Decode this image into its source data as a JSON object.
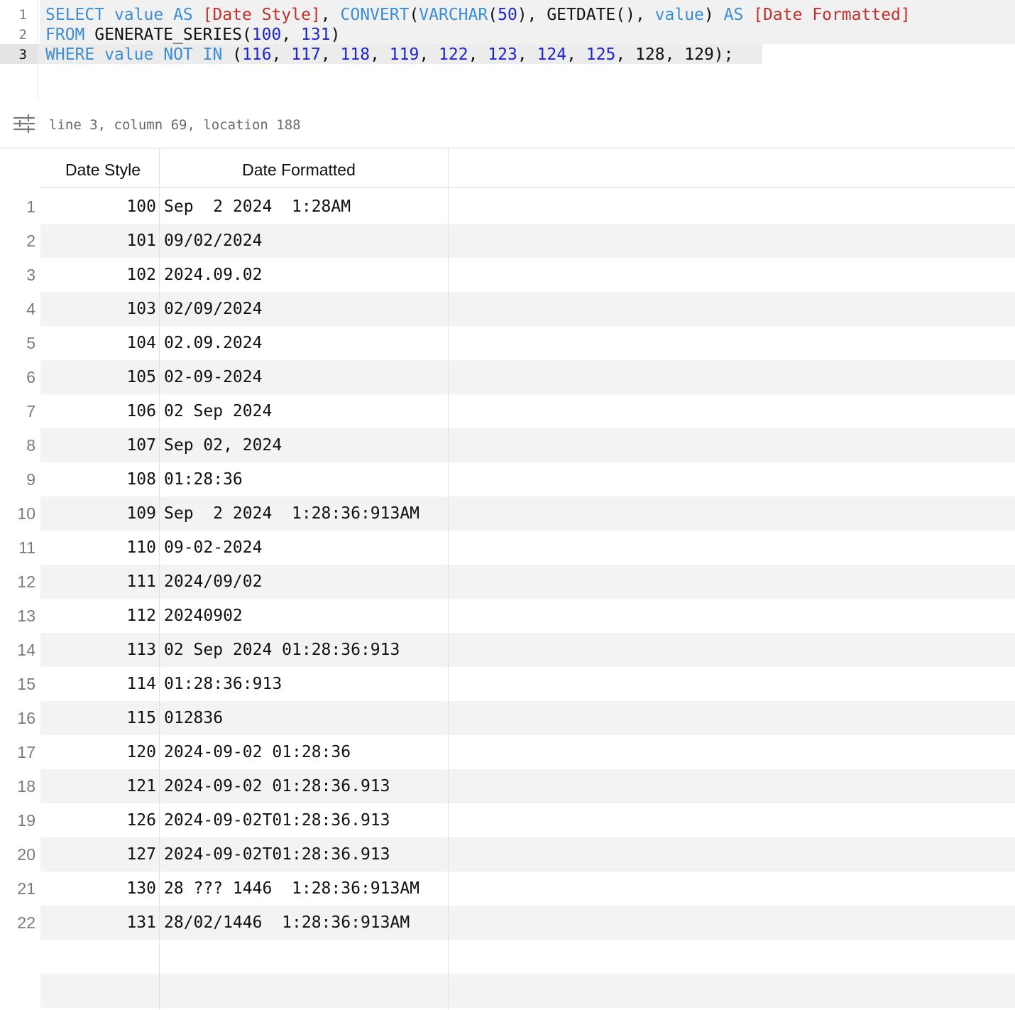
{
  "editor": {
    "line_numbers": [
      "1",
      "2",
      "3"
    ],
    "lines": [
      [
        {
          "t": "SELECT",
          "c": "kw"
        },
        {
          "t": " ",
          "c": "pl"
        },
        {
          "t": "value",
          "c": "kw"
        },
        {
          "t": " ",
          "c": "pl"
        },
        {
          "t": "AS",
          "c": "kw"
        },
        {
          "t": " ",
          "c": "pl"
        },
        {
          "t": "[Date Style]",
          "c": "str"
        },
        {
          "t": ", ",
          "c": "pl"
        },
        {
          "t": "CONVERT",
          "c": "kw"
        },
        {
          "t": "(",
          "c": "pl"
        },
        {
          "t": "VARCHAR",
          "c": "kw"
        },
        {
          "t": "(",
          "c": "pl"
        },
        {
          "t": "50",
          "c": "num"
        },
        {
          "t": "), GETDATE(), ",
          "c": "pl"
        },
        {
          "t": "value",
          "c": "kw"
        },
        {
          "t": ") ",
          "c": "pl"
        },
        {
          "t": "AS",
          "c": "kw"
        },
        {
          "t": " ",
          "c": "pl"
        },
        {
          "t": "[Date Formatted]",
          "c": "str"
        }
      ],
      [
        {
          "t": "FROM",
          "c": "kw"
        },
        {
          "t": " GENERATE_SERIES(",
          "c": "pl"
        },
        {
          "t": "100",
          "c": "num"
        },
        {
          "t": ", ",
          "c": "pl"
        },
        {
          "t": "131",
          "c": "num"
        },
        {
          "t": ")",
          "c": "pl"
        }
      ],
      [
        {
          "t": "WHERE",
          "c": "kw"
        },
        {
          "t": " ",
          "c": "pl"
        },
        {
          "t": "value",
          "c": "kw"
        },
        {
          "t": " ",
          "c": "pl"
        },
        {
          "t": "NOT",
          "c": "kw"
        },
        {
          "t": " ",
          "c": "pl"
        },
        {
          "t": "IN",
          "c": "kw"
        },
        {
          "t": " (",
          "c": "pl"
        },
        {
          "t": "116",
          "c": "num"
        },
        {
          "t": ", ",
          "c": "pl"
        },
        {
          "t": "117",
          "c": "num"
        },
        {
          "t": ", ",
          "c": "pl"
        },
        {
          "t": "118",
          "c": "num"
        },
        {
          "t": ", ",
          "c": "pl"
        },
        {
          "t": "119",
          "c": "num"
        },
        {
          "t": ", ",
          "c": "pl"
        },
        {
          "t": "122",
          "c": "num"
        },
        {
          "t": ", ",
          "c": "pl"
        },
        {
          "t": "123",
          "c": "num"
        },
        {
          "t": ", ",
          "c": "pl"
        },
        {
          "t": "124",
          "c": "num"
        },
        {
          "t": ", ",
          "c": "pl"
        },
        {
          "t": "125",
          "c": "num"
        },
        {
          "t": ", ",
          "c": "pl"
        },
        {
          "t": "128, 129);",
          "c": "pl"
        }
      ]
    ],
    "colors": {
      "keyword": "#3b8ed6",
      "string": "#c0302c",
      "number": "#1c22d6",
      "plain": "#111111"
    }
  },
  "status": {
    "settings_icon": "sliders-icon",
    "cursor_info": "line 3, column 69, location 188"
  },
  "results": {
    "columns": [
      "Date Style",
      "Date Formatted"
    ],
    "rows": [
      {
        "n": "1",
        "style": "100",
        "formatted": "Sep  2 2024  1:28AM"
      },
      {
        "n": "2",
        "style": "101",
        "formatted": "09/02/2024"
      },
      {
        "n": "3",
        "style": "102",
        "formatted": "2024.09.02"
      },
      {
        "n": "4",
        "style": "103",
        "formatted": "02/09/2024"
      },
      {
        "n": "5",
        "style": "104",
        "formatted": "02.09.2024"
      },
      {
        "n": "6",
        "style": "105",
        "formatted": "02-09-2024"
      },
      {
        "n": "7",
        "style": "106",
        "formatted": "02 Sep 2024"
      },
      {
        "n": "8",
        "style": "107",
        "formatted": "Sep 02, 2024"
      },
      {
        "n": "9",
        "style": "108",
        "formatted": "01:28:36"
      },
      {
        "n": "10",
        "style": "109",
        "formatted": "Sep  2 2024  1:28:36:913AM"
      },
      {
        "n": "11",
        "style": "110",
        "formatted": "09-02-2024"
      },
      {
        "n": "12",
        "style": "111",
        "formatted": "2024/09/02"
      },
      {
        "n": "13",
        "style": "112",
        "formatted": "20240902"
      },
      {
        "n": "14",
        "style": "113",
        "formatted": "02 Sep 2024 01:28:36:913"
      },
      {
        "n": "15",
        "style": "114",
        "formatted": "01:28:36:913"
      },
      {
        "n": "16",
        "style": "115",
        "formatted": "012836"
      },
      {
        "n": "17",
        "style": "120",
        "formatted": "2024-09-02 01:28:36"
      },
      {
        "n": "18",
        "style": "121",
        "formatted": "2024-09-02 01:28:36.913"
      },
      {
        "n": "19",
        "style": "126",
        "formatted": "2024-09-02T01:28:36.913"
      },
      {
        "n": "20",
        "style": "127",
        "formatted": "2024-09-02T01:28:36.913"
      },
      {
        "n": "21",
        "style": "130",
        "formatted": "28 ??? 1446  1:28:36:913AM"
      },
      {
        "n": "22",
        "style": "131",
        "formatted": "28/02/1446  1:28:36:913AM"
      }
    ]
  }
}
